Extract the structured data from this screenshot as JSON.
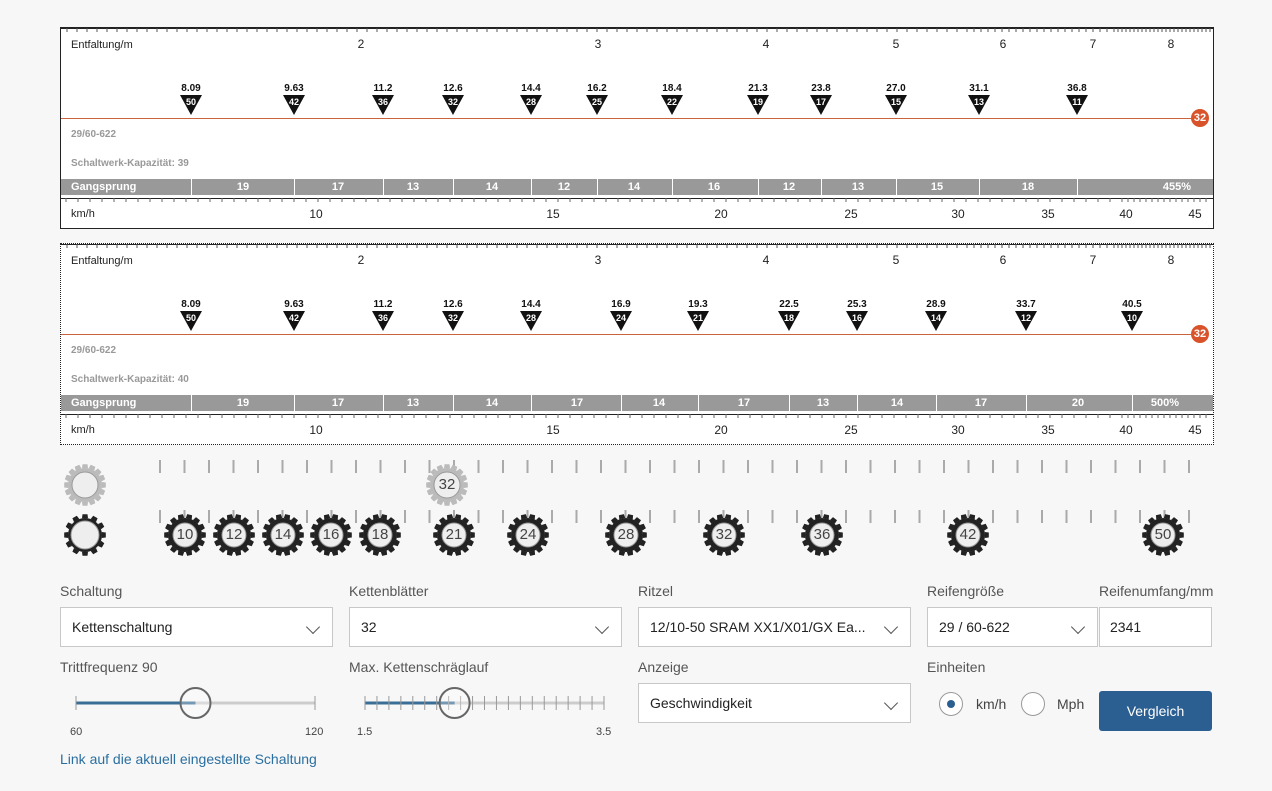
{
  "panels": [
    {
      "entfaltung_label": "Entfaltung/m",
      "entfaltung_ticks": [
        "2",
        "3",
        "4",
        "5",
        "6",
        "7",
        "8"
      ],
      "kmh_label": "km/h",
      "kmh_ticks": [
        "10",
        "15",
        "20",
        "25",
        "30",
        "35",
        "40",
        "45"
      ],
      "size_text": "29/60-622",
      "capacity_text": "Schaltwerk-Kapazität: 39",
      "chainring_badge": "32",
      "gangsprung_title": "Gangsprung",
      "gears": [
        {
          "value": "8.09",
          "cog": "50"
        },
        {
          "value": "9.63",
          "cog": "42"
        },
        {
          "value": "11.2",
          "cog": "36"
        },
        {
          "value": "12.6",
          "cog": "32"
        },
        {
          "value": "14.4",
          "cog": "28"
        },
        {
          "value": "16.2",
          "cog": "25"
        },
        {
          "value": "18.4",
          "cog": "22"
        },
        {
          "value": "21.3",
          "cog": "19"
        },
        {
          "value": "23.8",
          "cog": "17"
        },
        {
          "value": "27.0",
          "cog": "15"
        },
        {
          "value": "31.1",
          "cog": "13"
        },
        {
          "value": "36.8",
          "cog": "11"
        }
      ],
      "jumps": [
        "19",
        "17",
        "13",
        "14",
        "12",
        "14",
        "16",
        "12",
        "13",
        "15",
        "18",
        "455%"
      ]
    },
    {
      "entfaltung_label": "Entfaltung/m",
      "entfaltung_ticks": [
        "2",
        "3",
        "4",
        "5",
        "6",
        "7",
        "8"
      ],
      "kmh_label": "km/h",
      "kmh_ticks": [
        "10",
        "15",
        "20",
        "25",
        "30",
        "35",
        "40",
        "45"
      ],
      "size_text": "29/60-622",
      "capacity_text": "Schaltwerk-Kapazität: 40",
      "chainring_badge": "32",
      "gangsprung_title": "Gangsprung",
      "gears": [
        {
          "value": "8.09",
          "cog": "50"
        },
        {
          "value": "9.63",
          "cog": "42"
        },
        {
          "value": "11.2",
          "cog": "36"
        },
        {
          "value": "12.6",
          "cog": "32"
        },
        {
          "value": "14.4",
          "cog": "28"
        },
        {
          "value": "16.9",
          "cog": "24"
        },
        {
          "value": "19.3",
          "cog": "21"
        },
        {
          "value": "22.5",
          "cog": "18"
        },
        {
          "value": "25.3",
          "cog": "16"
        },
        {
          "value": "28.9",
          "cog": "14"
        },
        {
          "value": "33.7",
          "cog": "12"
        },
        {
          "value": "40.5",
          "cog": "10"
        }
      ],
      "jumps": [
        "19",
        "17",
        "13",
        "14",
        "17",
        "14",
        "17",
        "13",
        "14",
        "17",
        "20",
        "500%"
      ]
    }
  ],
  "gear_row": {
    "chainring_label": "32",
    "cogs": [
      "10",
      "12",
      "14",
      "16",
      "18",
      "21",
      "24",
      "28",
      "32",
      "36",
      "42",
      "50"
    ]
  },
  "form": {
    "schaltung": {
      "label": "Schaltung",
      "value": "Kettenschaltung"
    },
    "kettenblaetter": {
      "label": "Kettenblätter",
      "value": "32"
    },
    "ritzel": {
      "label": "Ritzel",
      "value": "12/10-50 SRAM XX1/X01/GX Ea..."
    },
    "reifen": {
      "label": "Reifengröße",
      "value": "29 / 60-622"
    },
    "umfang": {
      "label": "Reifenumfang/mm",
      "value": "2341"
    },
    "trittfrequenz": {
      "label": "Trittfrequenz 90",
      "min": "60",
      "max": "120",
      "value": 90,
      "range": [
        60,
        120
      ]
    },
    "schraeglauf": {
      "label": "Max. Kettenschräglauf",
      "min": "1.5",
      "max": "3.5",
      "value": 2.25,
      "range": [
        1.5,
        3.5
      ]
    },
    "anzeige": {
      "label": "Anzeige",
      "value": "Geschwindigkeit"
    },
    "einheiten": {
      "label": "Einheiten",
      "kmh": "km/h",
      "mph": "Mph",
      "selected": "km/h"
    },
    "vergleich_button": "Vergleich",
    "link_text": "Link auf die aktuell eingestellte Schaltung"
  },
  "colors": {
    "accent": "#2c5f91",
    "redline": "#c8643c",
    "badge": "#d9532a",
    "sprung": "#999999"
  }
}
